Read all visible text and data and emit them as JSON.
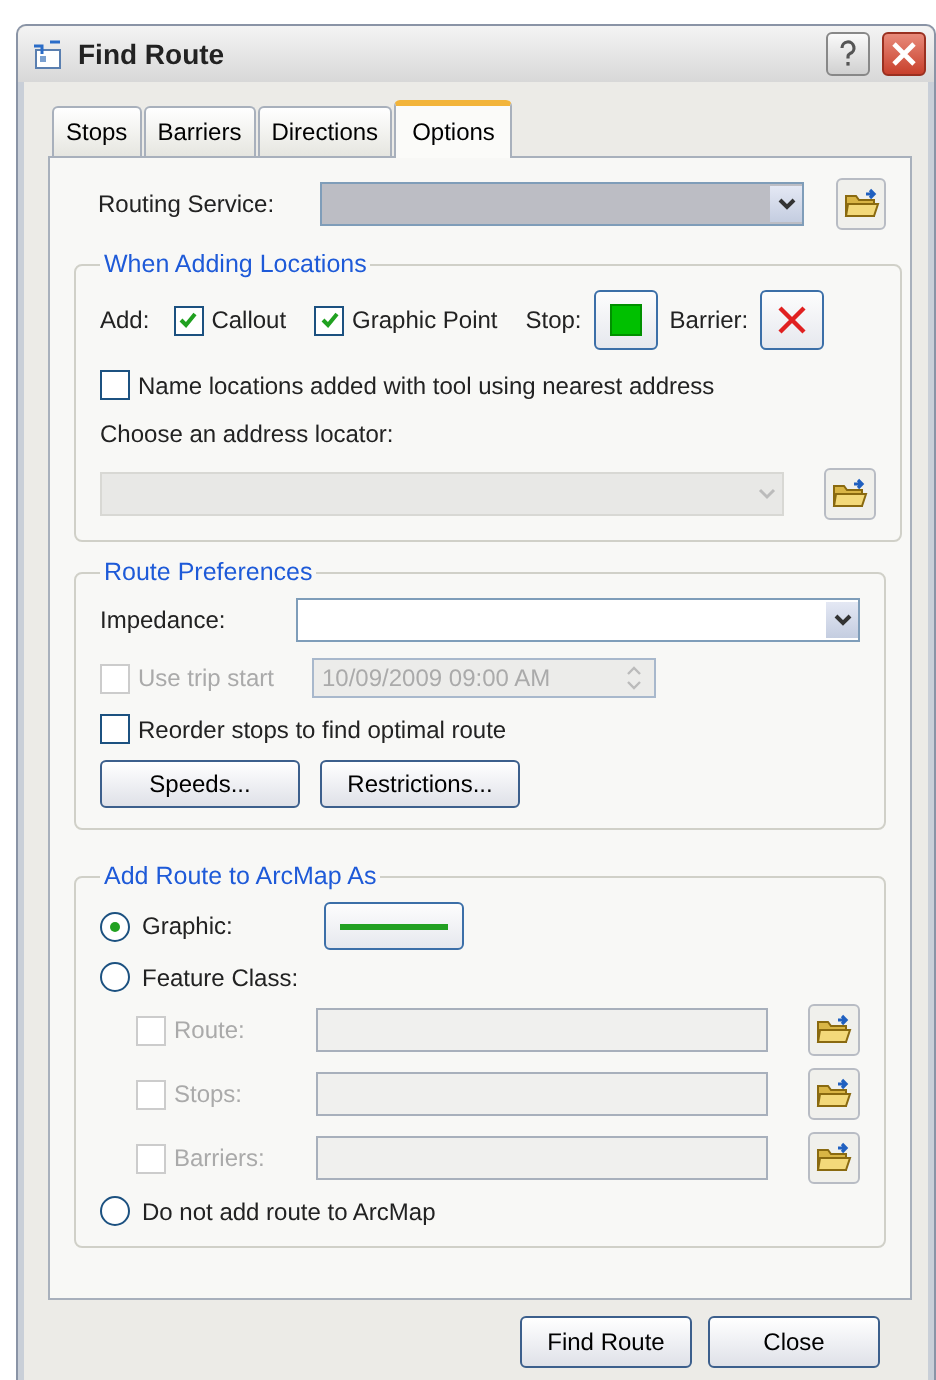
{
  "window": {
    "title": "Find Route"
  },
  "tabs": [
    {
      "label": "Stops",
      "selected": false
    },
    {
      "label": "Barriers",
      "selected": false
    },
    {
      "label": "Directions",
      "selected": false
    },
    {
      "label": "Options",
      "selected": true
    }
  ],
  "routing_service": {
    "label": "Routing Service:",
    "disabled": true
  },
  "when_adding": {
    "title": "When Adding Locations",
    "add_label": "Add:",
    "checkboxes": [
      {
        "label": "Callout",
        "checked": true
      },
      {
        "label": "Graphic Point",
        "checked": true
      }
    ],
    "stop_label": "Stop:",
    "barrier_label": "Barrier:",
    "name_locations": {
      "label": "Name locations added with tool using nearest address",
      "checked": false
    },
    "locator_label": "Choose an address locator:",
    "locator_disabled": true
  },
  "route_preferences": {
    "title": "Route Preferences",
    "impedance_label": "Impedance:",
    "impedance_disabled": false,
    "use_trip_start": {
      "label": "Use trip start",
      "checked": false,
      "disabled": true
    },
    "trip_start_value": "10/09/2009 09:00 AM",
    "reorder": {
      "label": "Reorder stops to find optimal route",
      "checked": false
    },
    "buttons": [
      "Speeds...",
      "Restrictions..."
    ]
  },
  "add_route": {
    "title": "Add Route to ArcMap As",
    "options": [
      {
        "label": "Graphic:",
        "selected": true
      },
      {
        "label": "Feature Class:",
        "selected": false
      },
      {
        "label": "Do not add route to ArcMap",
        "selected": false
      }
    ],
    "feature_layers": [
      {
        "label": "Route:",
        "checked": false,
        "disabled": true
      },
      {
        "label": "Stops:",
        "checked": false,
        "disabled": true
      },
      {
        "label": "Barriers:",
        "checked": false,
        "disabled": true
      }
    ]
  },
  "buttons": [
    "Find Route",
    "Close"
  ]
}
